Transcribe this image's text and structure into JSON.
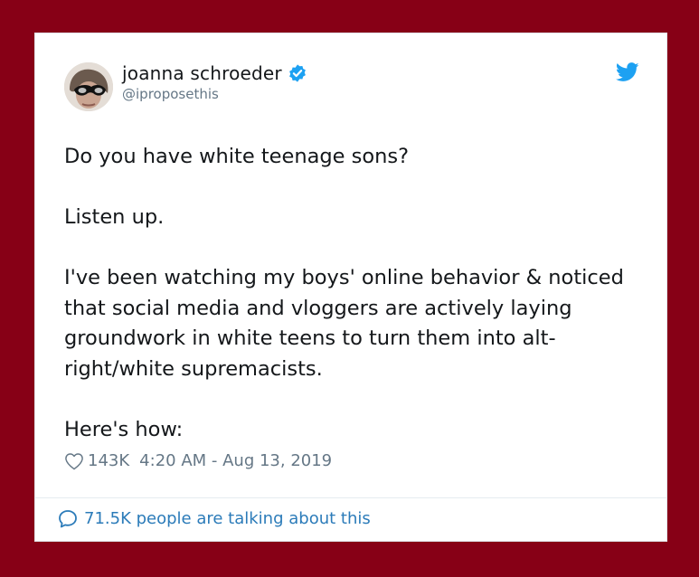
{
  "colors": {
    "background": "#870016",
    "card": "#ffffff",
    "text_primary": "#14171a",
    "text_secondary": "#657786",
    "link": "#2b7bb9",
    "twitter_blue": "#1da1f2"
  },
  "tweet": {
    "author": {
      "name": "joanna schroeder",
      "handle": "@iproposethis",
      "verified": true,
      "avatar_icon": "profile-photo"
    },
    "brand_icon": "twitter-bird-icon",
    "paragraphs": [
      "Do you have white teenage sons?",
      "Listen up.",
      "I've been watching my boys' online behavior & noticed that social media and vloggers are actively laying groundwork in white teens to turn them into alt-right/white supremacists.",
      "Here's how:"
    ],
    "likes": "143K",
    "timestamp": "4:20 AM - Aug 13, 2019",
    "conversation": "71.5K people are talking about this"
  }
}
